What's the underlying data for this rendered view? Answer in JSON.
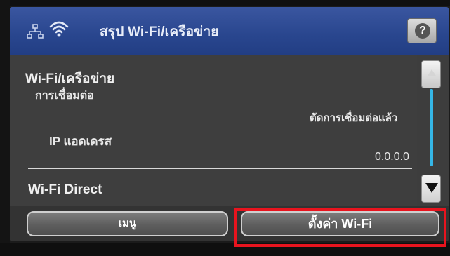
{
  "header": {
    "title": "สรุป Wi-Fi/เครือข่าย",
    "help_label": "?",
    "icons": [
      "network-icon",
      "wifi-icon",
      "help-icon"
    ]
  },
  "summary": {
    "section_title": "Wi-Fi/เครือข่าย",
    "connection_label": "การเชื่อมต่อ",
    "connection_value": "ตัดการเชื่อมต่อแล้ว",
    "ip_label": "IP แอดเดรส",
    "ip_value": "0.0.0.0",
    "next_section_title": "Wi-Fi Direct"
  },
  "footer": {
    "menu_label": "เมนู",
    "wifi_setup_label": "ตั้งค่า Wi-Fi"
  },
  "colors": {
    "title_bar": "#2a478e",
    "scroll_thumb": "#35b6e6",
    "highlight_box": "#e8141e"
  }
}
